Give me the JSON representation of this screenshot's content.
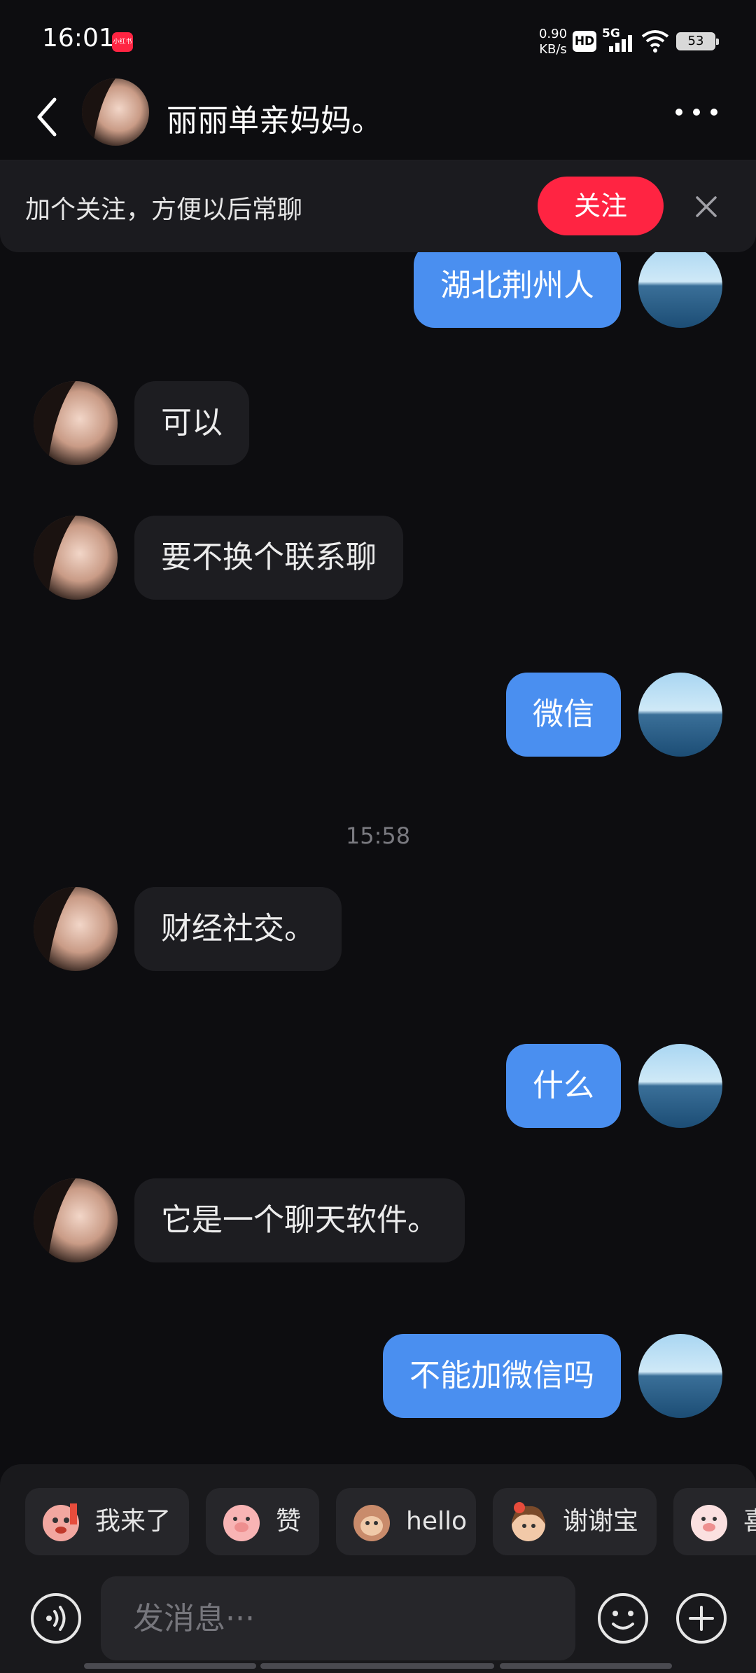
{
  "status_bar": {
    "time": "16:01",
    "app_badge": "小红书",
    "net_speed_value": "0.90",
    "net_speed_unit": "KB/s",
    "hd_label": "HD",
    "signal_label": "5G",
    "battery": "53"
  },
  "header": {
    "title": "丽丽单亲妈妈。",
    "back_icon": "chevron-left-icon",
    "more_icon": "more-dots-icon"
  },
  "follow_banner": {
    "text": "加个关注，方便以后常聊",
    "button_label": "关注",
    "close_icon": "close-icon"
  },
  "messages": [
    {
      "side": "right",
      "text": "湖北荆州人"
    },
    {
      "side": "left",
      "text": "可以"
    },
    {
      "side": "left",
      "text": "要不换个联系聊"
    },
    {
      "side": "right",
      "text": "微信"
    },
    {
      "side": "left",
      "text": "财经社交。"
    },
    {
      "side": "right",
      "text": "什么"
    },
    {
      "side": "left",
      "text": "它是一个聊天软件。"
    },
    {
      "side": "right",
      "text": "不能加微信吗"
    }
  ],
  "timestamp": "15:58",
  "quick_replies": [
    {
      "label": "我来了",
      "emoji": "monkey-sticker"
    },
    {
      "label": "赞",
      "emoji": "pig-sticker"
    },
    {
      "label": "hello",
      "emoji": "monkey-sticker"
    },
    {
      "label": "谢谢宝",
      "emoji": "girl-sticker"
    },
    {
      "label": "喜",
      "emoji": "pig-sticker"
    }
  ],
  "input": {
    "placeholder": "发消息···",
    "voice_icon": "voice-icon",
    "emoji_icon": "smile-icon",
    "plus_icon": "plus-icon"
  },
  "colors": {
    "background": "#0d0d10",
    "accent_red": "#ff2442",
    "my_bubble": "#4a8ff0",
    "their_bubble": "#1d1d21"
  }
}
